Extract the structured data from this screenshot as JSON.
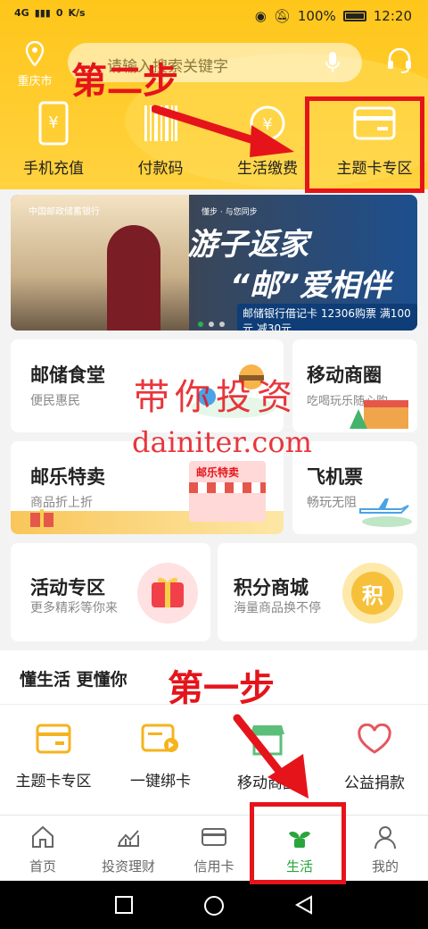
{
  "status_bar": {
    "network": "4G",
    "speed_value": "0",
    "speed_unit": "K/s",
    "battery": "100%",
    "time": "12:20"
  },
  "header": {
    "city": "重庆市",
    "search_placeholder": "请输入搜索关键字",
    "quick_actions": [
      {
        "label": "手机充值",
        "icon": "phone-yuan-icon"
      },
      {
        "label": "付款码",
        "icon": "barcode-icon"
      },
      {
        "label": "生活缴费",
        "icon": "bill-icon"
      },
      {
        "label": "主题卡专区",
        "icon": "card-icon"
      }
    ]
  },
  "banner": {
    "bank_name": "中国邮政储蓄银行",
    "slogan": "懂步 · 与您同步",
    "title_line1": "游子返家",
    "title_line2": "“邮”爱相伴",
    "promo": "邮储银行借记卡 12306购票 满100元 减30元",
    "slides": 3,
    "active_slide": 1
  },
  "cards": [
    {
      "title": "邮储食堂",
      "subtitle": "便民惠民"
    },
    {
      "title": "移动商圈",
      "subtitle": "吃喝玩乐随心购"
    },
    {
      "title": "邮乐特卖",
      "subtitle": "商品折上折",
      "badge": "邮乐特卖"
    },
    {
      "title": "飞机票",
      "subtitle": "畅玩无阻"
    },
    {
      "title": "活动专区",
      "subtitle": "更多精彩等你来"
    },
    {
      "title": "积分商城",
      "subtitle": "海量商品换不停",
      "badge": "积"
    }
  ],
  "section2": {
    "title": "懂生活  更懂你",
    "items": [
      {
        "label": "主题卡专区",
        "icon": "card-icon"
      },
      {
        "label": "一键绑卡",
        "icon": "bind-card-icon"
      },
      {
        "label": "移动商圈",
        "icon": "shop-icon"
      },
      {
        "label": "公益捐款",
        "icon": "heart-icon"
      }
    ]
  },
  "tabs": [
    {
      "label": "首页",
      "icon": "home-icon"
    },
    {
      "label": "投资理财",
      "icon": "chart-icon"
    },
    {
      "label": "信用卡",
      "icon": "credit-card-icon"
    },
    {
      "label": "生活",
      "icon": "sprout-icon",
      "active": true
    },
    {
      "label": "我的",
      "icon": "user-icon"
    }
  ],
  "annotations": {
    "step1": "第一步",
    "step2": "第二步"
  },
  "watermark": {
    "line1": "带你投资",
    "line2": "dainiter.com"
  },
  "colors": {
    "header": "#ffc61a",
    "accent_green": "#29a53c",
    "annotation_red": "#e5141b"
  }
}
